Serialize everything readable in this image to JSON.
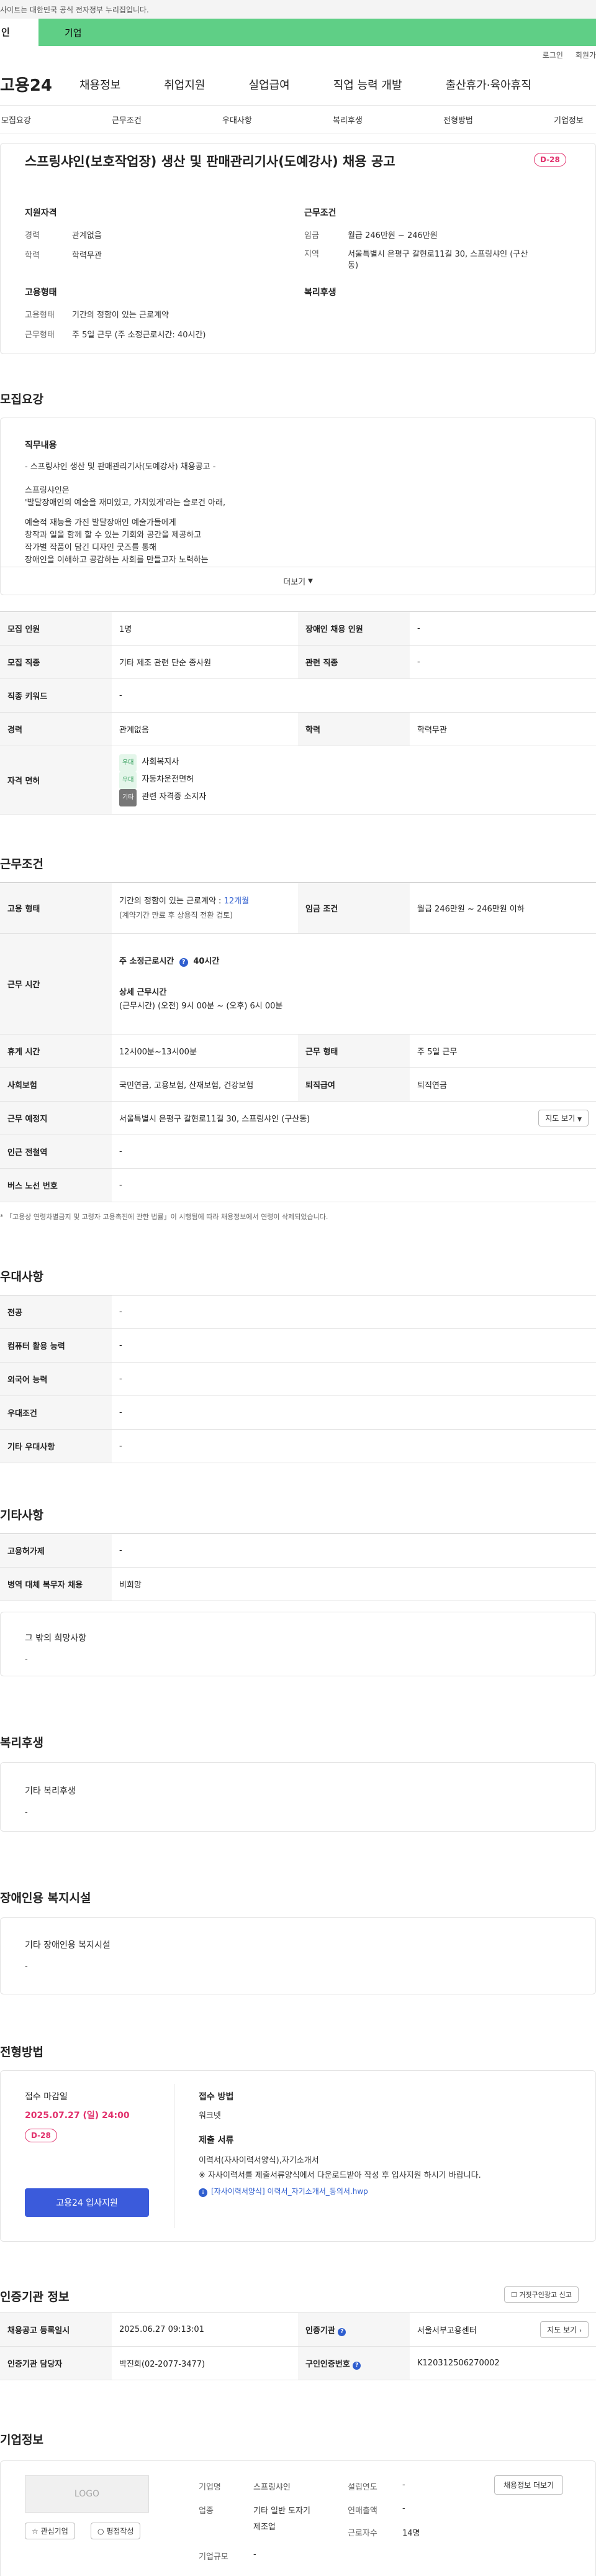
{
  "gov_bar": "사이트는 대한민국 공식 전자정부 누리집입니다.",
  "tabs": {
    "person": "인",
    "company": "기업"
  },
  "util": {
    "login": "로그인",
    "join": "회원가"
  },
  "logo": "고용24",
  "main_nav": [
    "채용정보",
    "취업지원",
    "실업급여",
    "직업 능력 개발",
    "출산휴가·육아휴직"
  ],
  "sub_nav": [
    "모집요강",
    "근무조건",
    "우대사항",
    "복리후생",
    "전형방법",
    "기업정보"
  ],
  "job": {
    "title": "스프링샤인(보호작업장) 생산 및 판매관리기사(도예강사) 채용 공고",
    "dday": "D-28",
    "qual_title": "지원자격",
    "qual": [
      {
        "label": "경력",
        "value": "관계없음"
      },
      {
        "label": "학력",
        "value": "학력무관"
      }
    ],
    "cond_title": "근무조건",
    "cond": [
      {
        "label": "임금",
        "value": "월급 246만원 ~ 246만원"
      },
      {
        "label": "지역",
        "value1": "서울특별시 은평구 갈현로11길 30, 스프링샤인 (구산",
        "value2": "동)"
      }
    ],
    "emp_title": "고용형태",
    "emp": [
      {
        "label": "고용형태",
        "value": "기간의 정함이 있는 근로계약"
      },
      {
        "label": "근무형태",
        "value": "주 5일 근무 (주 소정근로시간: 40시간)"
      }
    ],
    "welfare_title": "복리후생"
  },
  "recruit": {
    "title": "모집요강",
    "duty_title": "직무내용",
    "duty_lines": [
      "- 스프링샤인 생산 및 판매관리기사(도예강사) 채용공고 -",
      "스프링샤인은",
      "'발달장애인의 예술을 재미있고, 가치있게'라는 슬로건 아래,",
      "예술적 재능을 가진 발달장애인 예술가들에게",
      "창작과 일을 함께 할 수 있는 기회와 공간을 제공하고",
      "작가별 작품이 담긴 디자인 굿즈를 통해",
      "장애인을 이해하고 공감하는 사회를 만들고자 노력하는"
    ],
    "more": "더보기",
    "rows": [
      {
        "th1": "모집 인원",
        "td1": "1명",
        "th2": "장애인 채용 인원",
        "td2": "-"
      },
      {
        "th1": "모집 직종",
        "td1": "기타 제조 관련 단순 종사원",
        "th2": "관련 직종",
        "td2": "-"
      },
      {
        "th1": "직종 키워드",
        "td1": "-"
      },
      {
        "th1": "경력",
        "td1": "관계없음",
        "th2": "학력",
        "td2": "학력무관"
      }
    ],
    "license_th": "자격 면허",
    "licenses": [
      {
        "tag": "우대",
        "name": "사회복지사"
      },
      {
        "tag": "우대",
        "name": "자동차운전면허"
      },
      {
        "tag": "기타",
        "name": "관련 자격증 소지자"
      }
    ]
  },
  "work": {
    "title": "근무조건",
    "emp_th": "고용 형태",
    "emp_td1": "기간의 정함이 있는 근로계약 : ",
    "emp_months": "12개월",
    "emp_td2": "(계약기간 만료 후 상용직 전환 검토)",
    "wage_th": "임금 조건",
    "wage_td": "월급 246만원 ~ 246만원 이하",
    "time_th": "근무 시간",
    "weekly": "주 소정근로시간",
    "weekly_hours": "40시간",
    "detail_title": "상세 근무시간",
    "detail": "(근무시간) (오전) 9시 00분 ~ (오후) 6시 00분",
    "rows": [
      {
        "th1": "휴게 시간",
        "td1": "12시00분~13시00분",
        "th2": "근무 형태",
        "td2": "주 5일 근무"
      },
      {
        "th1": "사회보험",
        "td1": "국민연금, 고용보험, 산재보험, 건강보험",
        "th2": "퇴직급여",
        "td2": "퇴직연금"
      }
    ],
    "place_th": "근무 예정지",
    "place_td": "서울특별시 은평구 갈현로11길 30, 스프링샤인 (구산동)",
    "map_btn": "지도 보기",
    "subway_th": "인근 전철역",
    "subway_td": "-",
    "bus_th": "버스 노선 번호",
    "bus_td": "-",
    "note": "* 「고용상 연령차별금지 및 고령자 고용촉진에 관한 법률」이 시행됨에 따라 채용정보에서 연령이 삭제되었습니다."
  },
  "pref": {
    "title": "우대사항",
    "rows": [
      {
        "th": "전공",
        "td": "-"
      },
      {
        "th": "컴퓨터 활용 능력",
        "td": "-"
      },
      {
        "th": "외국어 능력",
        "td": "-"
      },
      {
        "th": "우대조건",
        "td": "-"
      },
      {
        "th": "기타 우대사항",
        "td": "-"
      }
    ]
  },
  "etc": {
    "title": "기타사항",
    "rows": [
      {
        "th": "고용허가제",
        "td": "-"
      },
      {
        "th": "병역 대체 복무자 채용",
        "td": "비희망"
      }
    ],
    "other_title": "그 밖의 희망사항",
    "other_value": "-"
  },
  "welfare": {
    "title": "복리후생",
    "box_title": "기타 복리후생",
    "box_value": "-"
  },
  "disabled": {
    "title": "장애인용 복지시설",
    "box_title": "기타 장애인용 복지시설",
    "box_value": "-"
  },
  "screen": {
    "title": "전형방법",
    "deadline_label": "접수 마감일",
    "deadline": "2025.07.27 (일) 24:00",
    "dday": "D-28",
    "apply_btn": "고용24 입사지원",
    "method_label": "접수 방법",
    "method": "워크넷",
    "docs_label": "제출 서류",
    "docs1": "이력서(자사이력서양식),자기소개서",
    "docs2": "※ 자사이력서를 제출서류양식에서 다운로드받아 작성 후 입사지원 하시기 바랍니다.",
    "file": "[자사이력서양식] 이력서_자기소개서_동의서.hwp"
  },
  "cert": {
    "title": "인증기관 정보",
    "report_btn": "거짓구인광고 신고",
    "rows": [
      {
        "th1": "채용공고 등록일시",
        "td1": "2025.06.27 09:13:01",
        "th2": "인증기관",
        "td2": "서울서부고용센터"
      },
      {
        "th1": "인증기관 담당자",
        "td1": "박진희(02-2077-3477)",
        "th2": "구인인증번호",
        "td2": "K120312506270002"
      }
    ],
    "map_btn": "지도 보기"
  },
  "company": {
    "title": "기업정보",
    "logo": "LOGO",
    "fav_btn": "관심기업",
    "rate_btn": "평점작성",
    "name_l": "기업명",
    "name_v": "스프링샤인",
    "ind_l": "업종",
    "ind_v1": "기타 일반 도자기",
    "ind_v2": "제조업",
    "size_l": "기업규모",
    "size_v": "-",
    "year_l": "설립연도",
    "year_v": "-",
    "sales_l": "연매출액",
    "sales_v": "-",
    "emp_l": "근로자수",
    "emp_v": "14명",
    "more_btn": "채용정보 더보기"
  }
}
